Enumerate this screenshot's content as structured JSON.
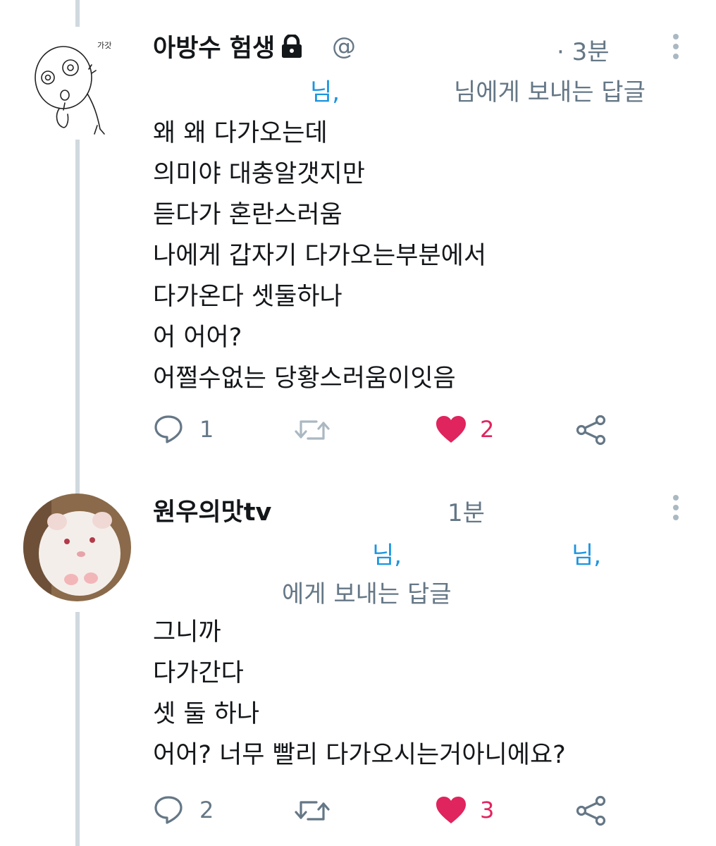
{
  "tweets": [
    {
      "name": "아방수 험생",
      "handle": "@",
      "time": "· 3분",
      "reply_to": {
        "mention": "님,",
        "rest": "님에게 보내는 답글"
      },
      "text": "왜 왜 다가오는데\n의미야 대충알갯지만\n듣다가 혼란스러움\n나에게 갑자기 다가오는부분에서\n다가온다 셋둘하나\n어 어어?\n어쩔수없는 당황스러움이잇음",
      "avatar_doodle_text": "가갓",
      "actions": {
        "reply_count": "1",
        "retweet_count": "",
        "like_count": "2"
      }
    },
    {
      "name": "원우의맛tv",
      "time": "1분",
      "reply_to": {
        "mention1": "님,",
        "mention2": "님,",
        "rest": "에게 보내는 답글"
      },
      "text": "그니까\n다가간다\n셋 둘 하나\n어어? 너무 빨리 다가오시는거아니에요?",
      "actions": {
        "reply_count": "2",
        "retweet_count": "",
        "like_count": "3"
      }
    }
  ],
  "icons": {
    "reply": "reply-bubble-icon",
    "retweet": "retweet-icon",
    "like": "heart-filled-icon",
    "share": "share-icon",
    "more": "more-vertical-icon",
    "lock": "lock-icon"
  },
  "colors": {
    "like": "#e0245e",
    "mention": "#1b95e0",
    "muted": "#657786",
    "thread_line": "#cfd9de"
  }
}
